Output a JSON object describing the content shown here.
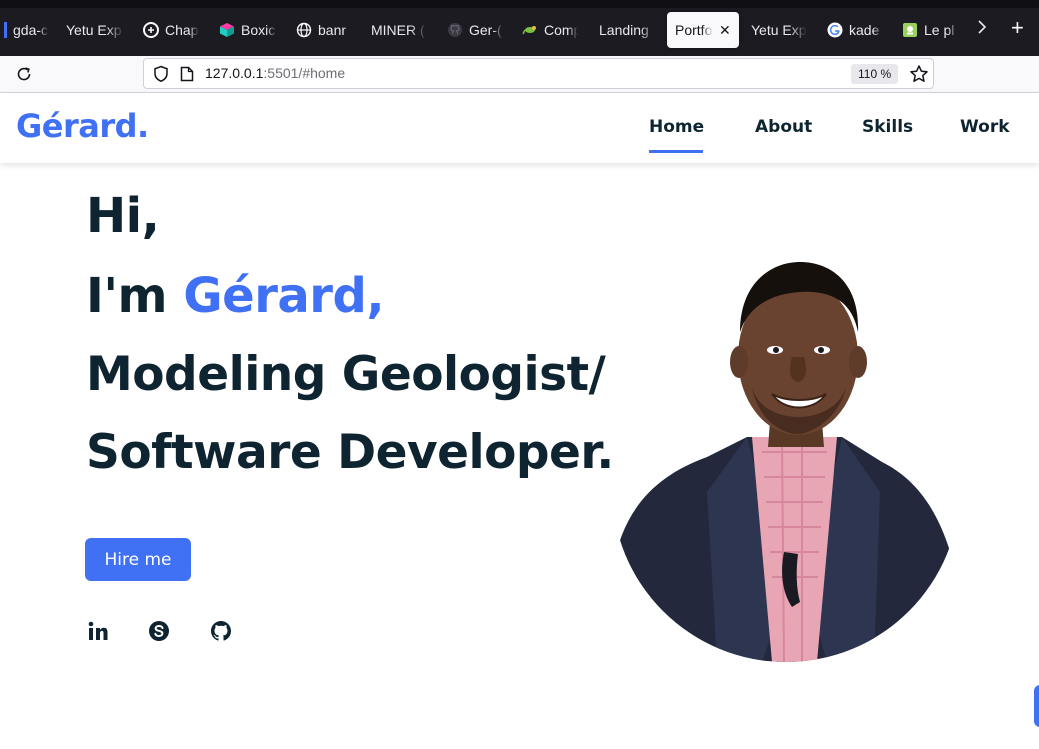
{
  "browser": {
    "tabs": [
      {
        "label": "gda-c",
        "icon": "blank-icon"
      },
      {
        "label": "Yetu Exp",
        "icon": "none"
      },
      {
        "label": "Chap",
        "icon": "chatgpt-icon"
      },
      {
        "label": "Boxic",
        "icon": "boxicons-icon"
      },
      {
        "label": "banr",
        "icon": "globe-icon"
      },
      {
        "label": "MINER (",
        "icon": "none"
      },
      {
        "label": "Ger-(",
        "icon": "github-icon"
      },
      {
        "label": "Comp",
        "icon": "lizard-icon"
      },
      {
        "label": "Landing",
        "icon": "none"
      },
      {
        "label": "Portfo",
        "icon": "none",
        "active": true
      },
      {
        "label": "Yetu Exp",
        "icon": "none"
      },
      {
        "label": "kade",
        "icon": "google-icon"
      },
      {
        "label": "Le pl",
        "icon": "page-icon"
      }
    ],
    "new_tab_label": "+",
    "url_host": "127.0.0.1",
    "url_rest": ":5501/#home",
    "zoom": "110 %"
  },
  "site": {
    "logo": "Gérard.",
    "nav": [
      {
        "label": "Home",
        "active": true
      },
      {
        "label": "About"
      },
      {
        "label": "Skills"
      },
      {
        "label": "Work"
      }
    ],
    "hero": {
      "line1": "Hi,",
      "line2_prefix": "I'm ",
      "line2_name": "Gérard,",
      "line3": "Modeling Geologist/",
      "line4": "Software Developer."
    },
    "cta": "Hire me",
    "socials": [
      "linkedin-icon",
      "skype-icon",
      "github-icon"
    ]
  },
  "colors": {
    "accent": "#4070f4",
    "text_dark": "#0e2431",
    "chrome_dark": "#1c1b22"
  }
}
